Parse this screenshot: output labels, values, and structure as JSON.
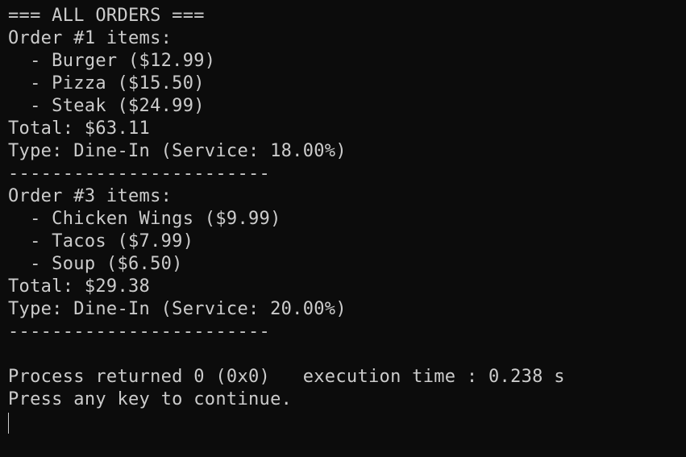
{
  "console": {
    "lines": [
      "=== ALL ORDERS ===",
      "Order #1 items:",
      "  - Burger ($12.99)",
      "  - Pizza ($15.50)",
      "  - Steak ($24.99)",
      "Total: $63.11",
      "Type: Dine-In (Service: 18.00%)",
      "------------------------",
      "Order #3 items:",
      "  - Chicken Wings ($9.99)",
      "  - Tacos ($7.99)",
      "  - Soup ($6.50)",
      "Total: $29.38",
      "Type: Dine-In (Service: 20.00%)",
      "------------------------",
      "",
      "Process returned 0 (0x0)   execution time : 0.238 s",
      "Press any key to continue."
    ]
  },
  "colors": {
    "background": "#0c0c0c",
    "foreground": "#cccccc"
  }
}
